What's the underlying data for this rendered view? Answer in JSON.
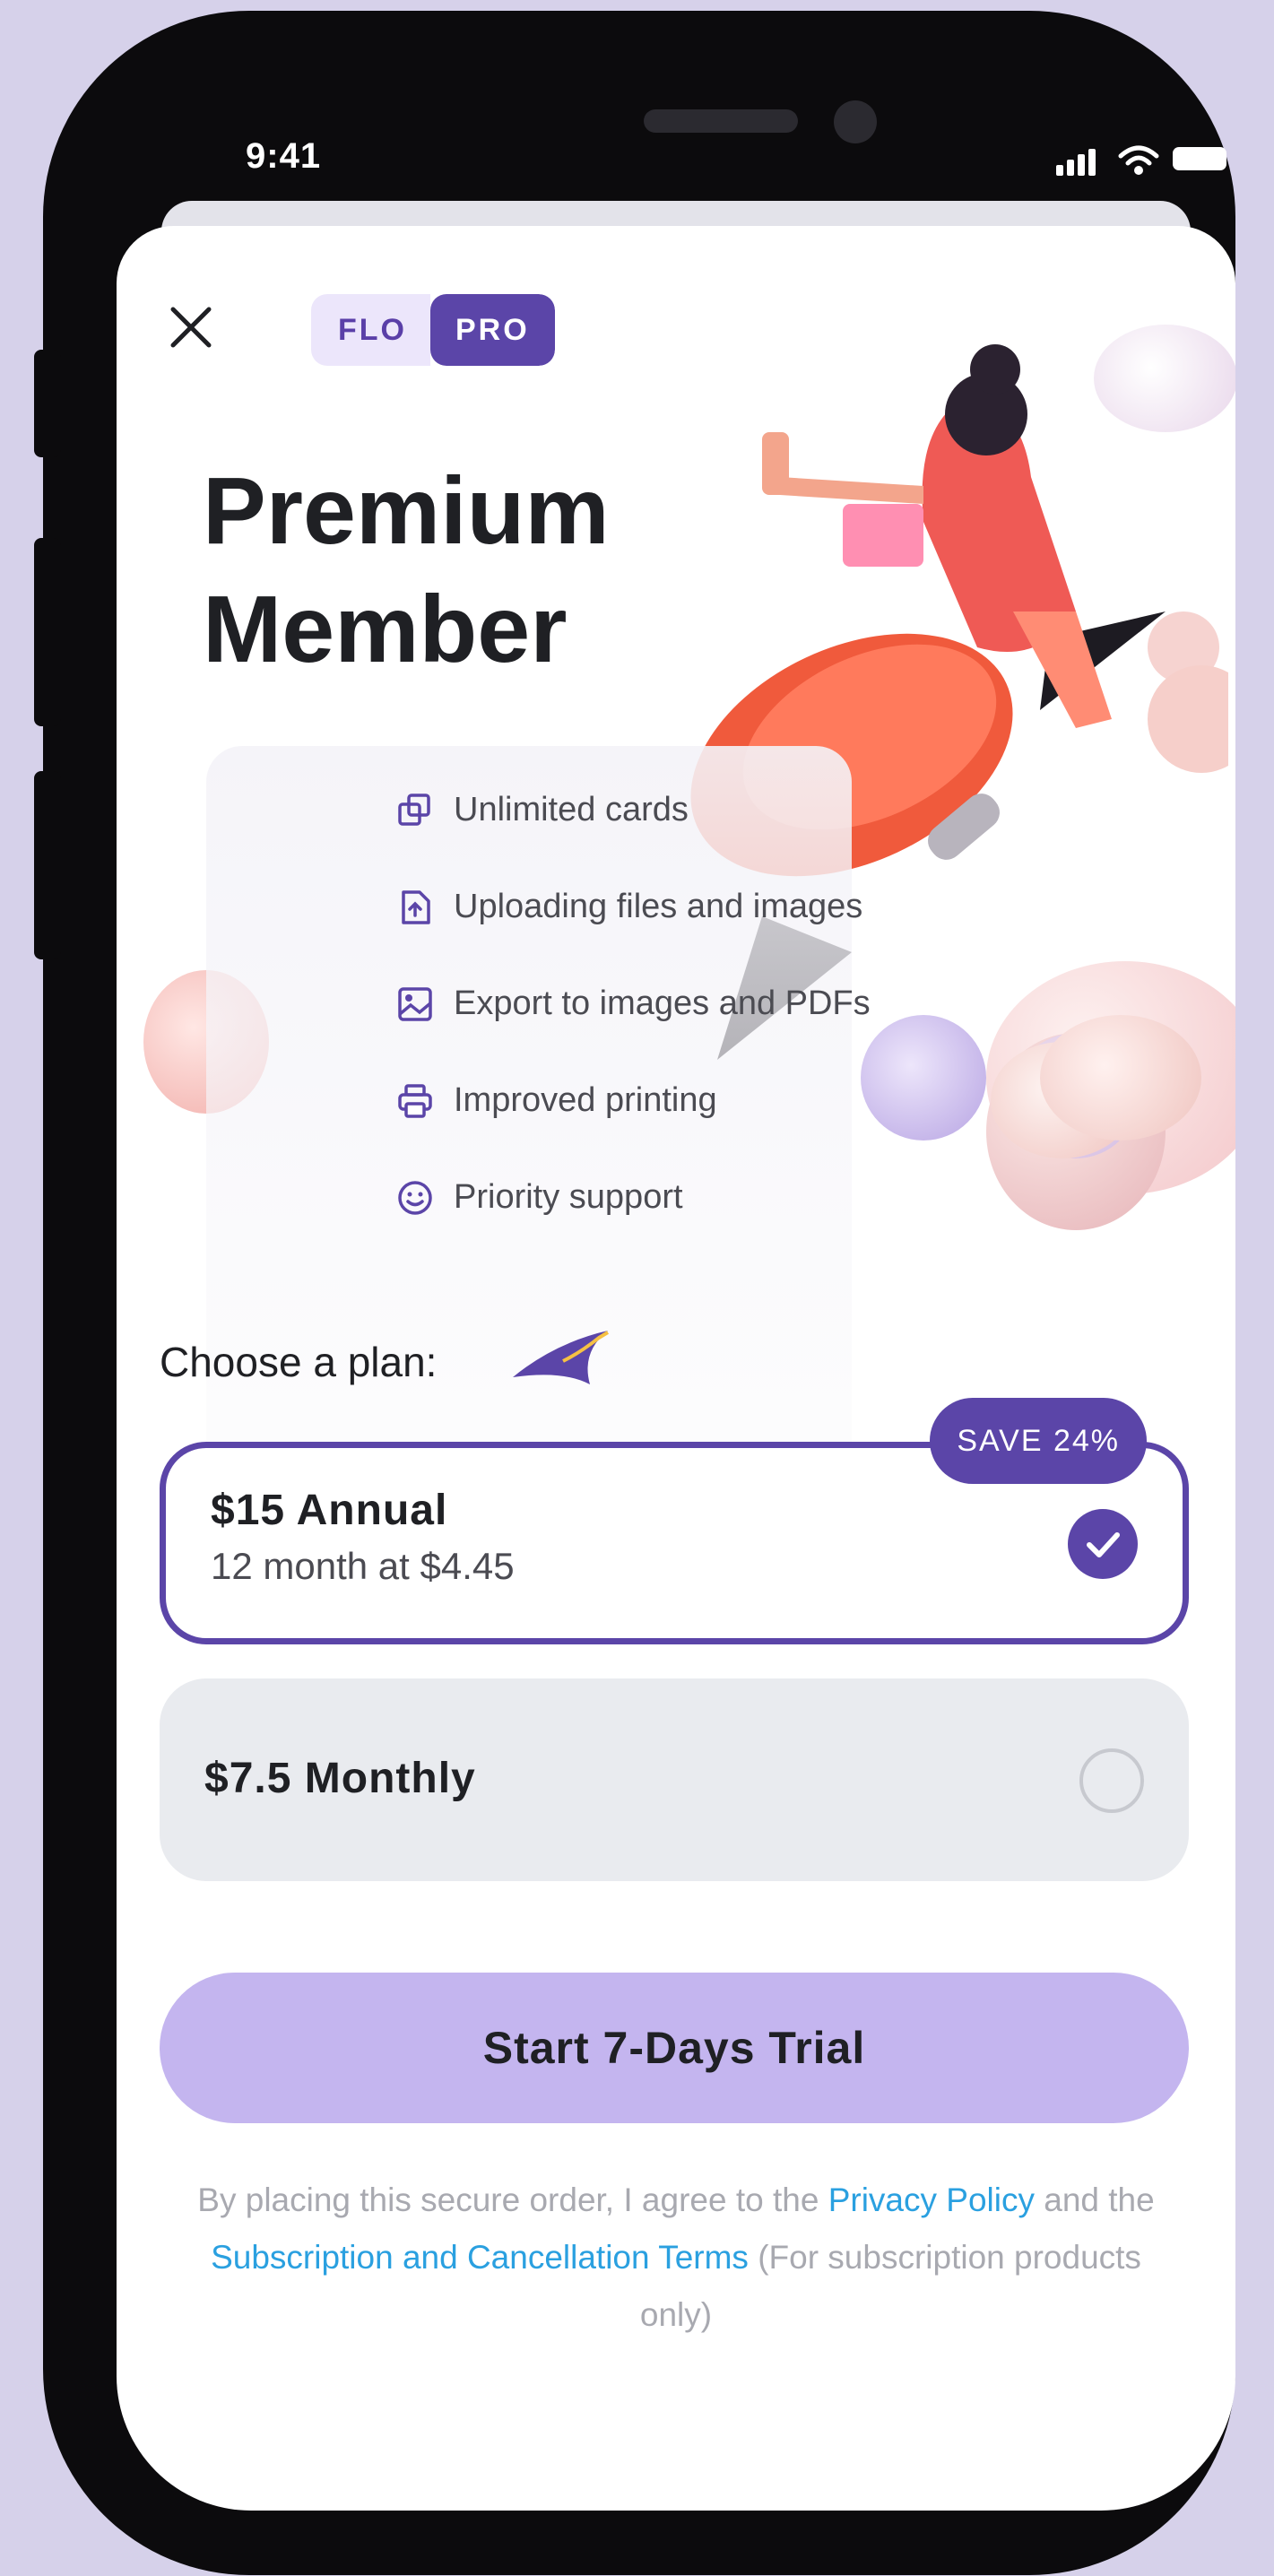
{
  "status_bar": {
    "time": "9:41"
  },
  "header": {
    "badge_left": "FLO",
    "badge_right": "PRO"
  },
  "hero": {
    "title_line1": "Premium",
    "title_line2": "Member"
  },
  "features": [
    {
      "icon": "copy-icon",
      "label": "Unlimited cards"
    },
    {
      "icon": "file-upload-icon",
      "label": "Uploading files and images"
    },
    {
      "icon": "image-icon",
      "label": "Export to images and PDFs"
    },
    {
      "icon": "printer-icon",
      "label": "Improved printing"
    },
    {
      "icon": "smile-icon",
      "label": "Priority support"
    }
  ],
  "plans": {
    "label": "Choose a plan:",
    "annual": {
      "name": "$15 Annual",
      "sub": "12 month at $4.45",
      "badge": "SAVE 24%",
      "selected": true
    },
    "monthly": {
      "name": "$7.5 Monthly",
      "selected": false
    }
  },
  "cta": {
    "label": "Start 7-Days Trial"
  },
  "legal": {
    "part1": "By placing this secure order, I agree to the ",
    "link1": "Privacy Policy",
    "part2": " and the ",
    "link2": "Subscription and Cancellation Terms",
    "part3": " (For subscription products only)"
  },
  "colors": {
    "accent": "#5b45a8",
    "cta": "#c4b5ef",
    "link": "#2aa0e0",
    "background": "#d6d1ea"
  }
}
